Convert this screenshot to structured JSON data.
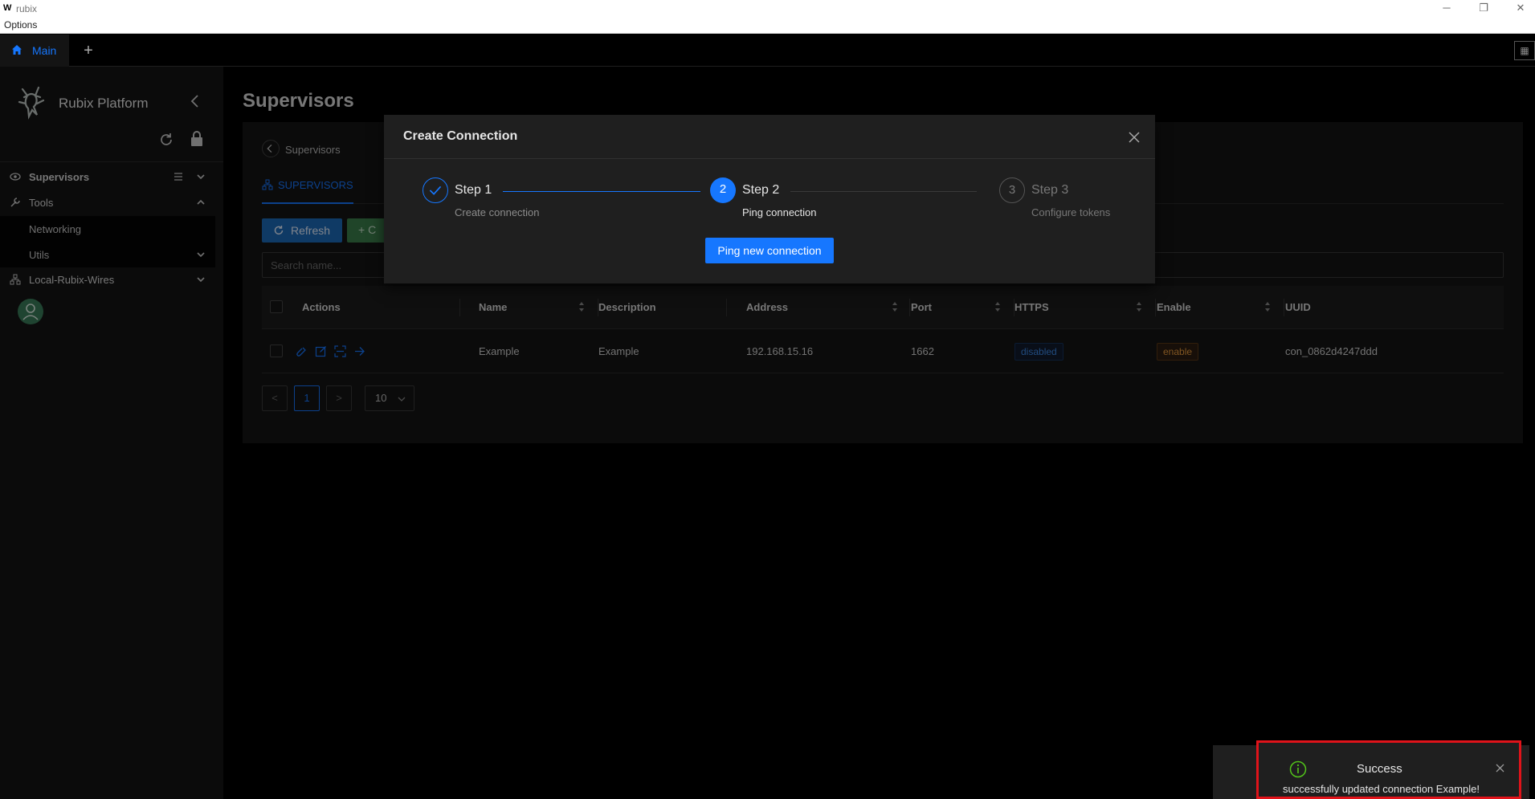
{
  "window": {
    "app_title": "rubix",
    "menu_options": "Options"
  },
  "tabbar": {
    "main_tab": "Main",
    "add_tab": "+"
  },
  "sidebar": {
    "brand": "Rubix Platform",
    "items": [
      {
        "label": "Supervisors"
      },
      {
        "label": "Tools"
      },
      {
        "label": "Networking"
      },
      {
        "label": "Utils"
      },
      {
        "label": "Local-Rubix-Wires"
      }
    ]
  },
  "main": {
    "page_title": "Supervisors",
    "breadcrumb": "Supervisors",
    "tab_supervisors": "SUPERVISORS",
    "refresh_label": "Refresh",
    "create_label": "+ C",
    "search_placeholder": "Search name...",
    "table": {
      "columns": [
        "Actions",
        "Name",
        "Description",
        "Address",
        "Port",
        "HTTPS",
        "Enable",
        "UUID"
      ],
      "rows": [
        {
          "name": "Example",
          "description": "Example",
          "address": "192.168.15.16",
          "port": "1662",
          "https": "disabled",
          "enable": "enable",
          "uuid": "con_0862d4247ddd"
        }
      ]
    },
    "pagination": {
      "prev": "<",
      "current": "1",
      "next": ">",
      "page_size": "10"
    }
  },
  "modal": {
    "title": "Create Connection",
    "steps": [
      {
        "number": "1",
        "title": "Step 1",
        "description": "Create connection",
        "status": "finish"
      },
      {
        "number": "2",
        "title": "Step 2",
        "description": "Ping connection",
        "status": "process"
      },
      {
        "number": "3",
        "title": "Step 3",
        "description": "Configure tokens",
        "status": "wait"
      }
    ],
    "ping_button": "Ping new connection"
  },
  "notification": {
    "title": "Success",
    "message": "successfully updated connection Example!"
  },
  "colors": {
    "accent": "#1677ff",
    "success": "#52c41a",
    "highlight": "#e0131a"
  }
}
